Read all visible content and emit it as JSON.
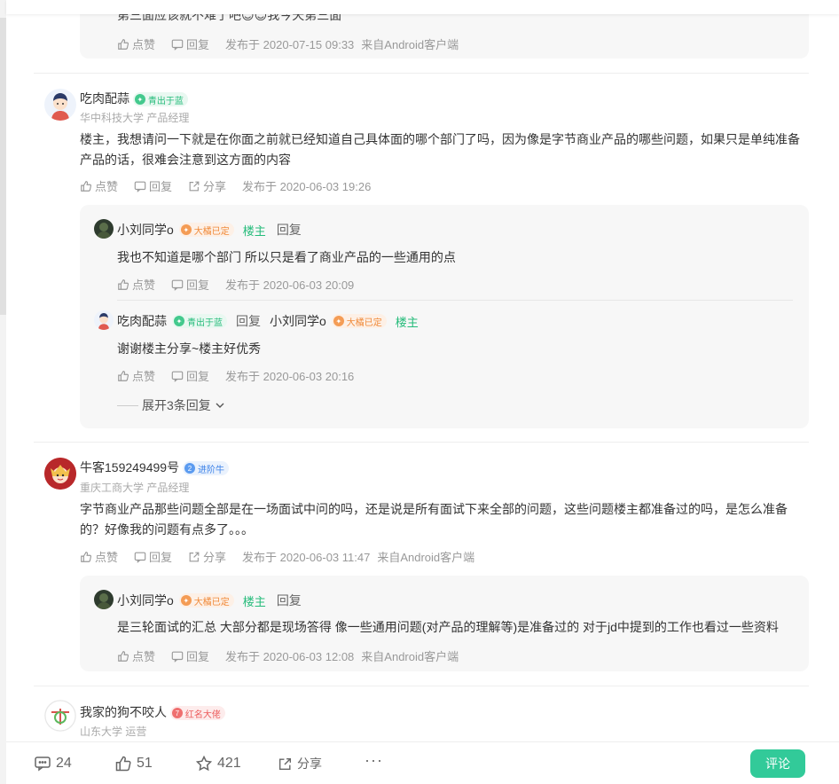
{
  "post0": {
    "text": "第三面应该就不难了吧😊😊我今天第三面",
    "like_label": "点赞",
    "reply_label": "回复",
    "time": "发布于 2020-07-15 09:33",
    "source": "来自Android客户端"
  },
  "comment1": {
    "name": "吃肉配蒜",
    "badge": "青出于蓝",
    "school": "华中科技大学 产品经理",
    "text": "楼主，我想请问一下就是在你面之前就已经知道自己具体面的哪个部门了吗，因为像是字节商业产品的哪些问题，如果只是单纯准备产品的话，很难会注意到这方面的内容",
    "like_label": "点赞",
    "reply_label": "回复",
    "share_label": "分享",
    "time": "发布于 2020-06-03 19:26",
    "replies": [
      {
        "name": "小刘同学o",
        "badge": "大橘已定",
        "op_label": "楼主",
        "reply_label": "回复",
        "text": "我也不知道是哪个部门 所以只是看了商业产品的一些通用的点",
        "like_label": "点赞",
        "action_reply": "回复",
        "time": "发布于 2020-06-03 20:09"
      },
      {
        "name": "吃肉配蒜",
        "badge": "青出于蓝",
        "reply_word": "回复",
        "target_name": "小刘同学o",
        "target_badge": "大橘已定",
        "op_label": "楼主",
        "text": "谢谢楼主分享~楼主好优秀",
        "like_label": "点赞",
        "action_reply": "回复",
        "time": "发布于 2020-06-03 20:16"
      }
    ],
    "expand_label": "展开3条回复"
  },
  "comment2": {
    "name": "牛客159249499号",
    "badge": "进阶牛",
    "school": "重庆工商大学 产品经理",
    "text": "字节商业产品那些问题全部是在一场面试中问的吗，还是说是所有面试下来全部的问题，这些问题楼主都准备过的吗，是怎么准备的？好像我的问题有点多了。。。",
    "like_label": "点赞",
    "reply_label": "回复",
    "share_label": "分享",
    "time": "发布于 2020-06-03 11:47",
    "source": "来自Android客户端",
    "reply": {
      "name": "小刘同学o",
      "badge": "大橘已定",
      "op_label": "楼主",
      "reply_label": "回复",
      "text": "是三轮面试的汇总 大部分都是现场答得  像一些通用问题(对产品的理解等)是准备过的  对于jd中提到的工作也看过一些资料",
      "like_label": "点赞",
      "action_reply": "回复",
      "time": "发布于 2020-06-03 12:08",
      "source": "来自Android客户端"
    }
  },
  "comment3": {
    "name": "我家的狗不咬人",
    "badge": "红名大佬",
    "school": "山东大学 运营"
  },
  "bottom": {
    "comments": "24",
    "likes": "51",
    "favorites": "421",
    "share": "分享",
    "more": "···",
    "comment_button": "评论"
  },
  "colors": {
    "accent": "#32ca99",
    "op": "#25bb7a"
  }
}
